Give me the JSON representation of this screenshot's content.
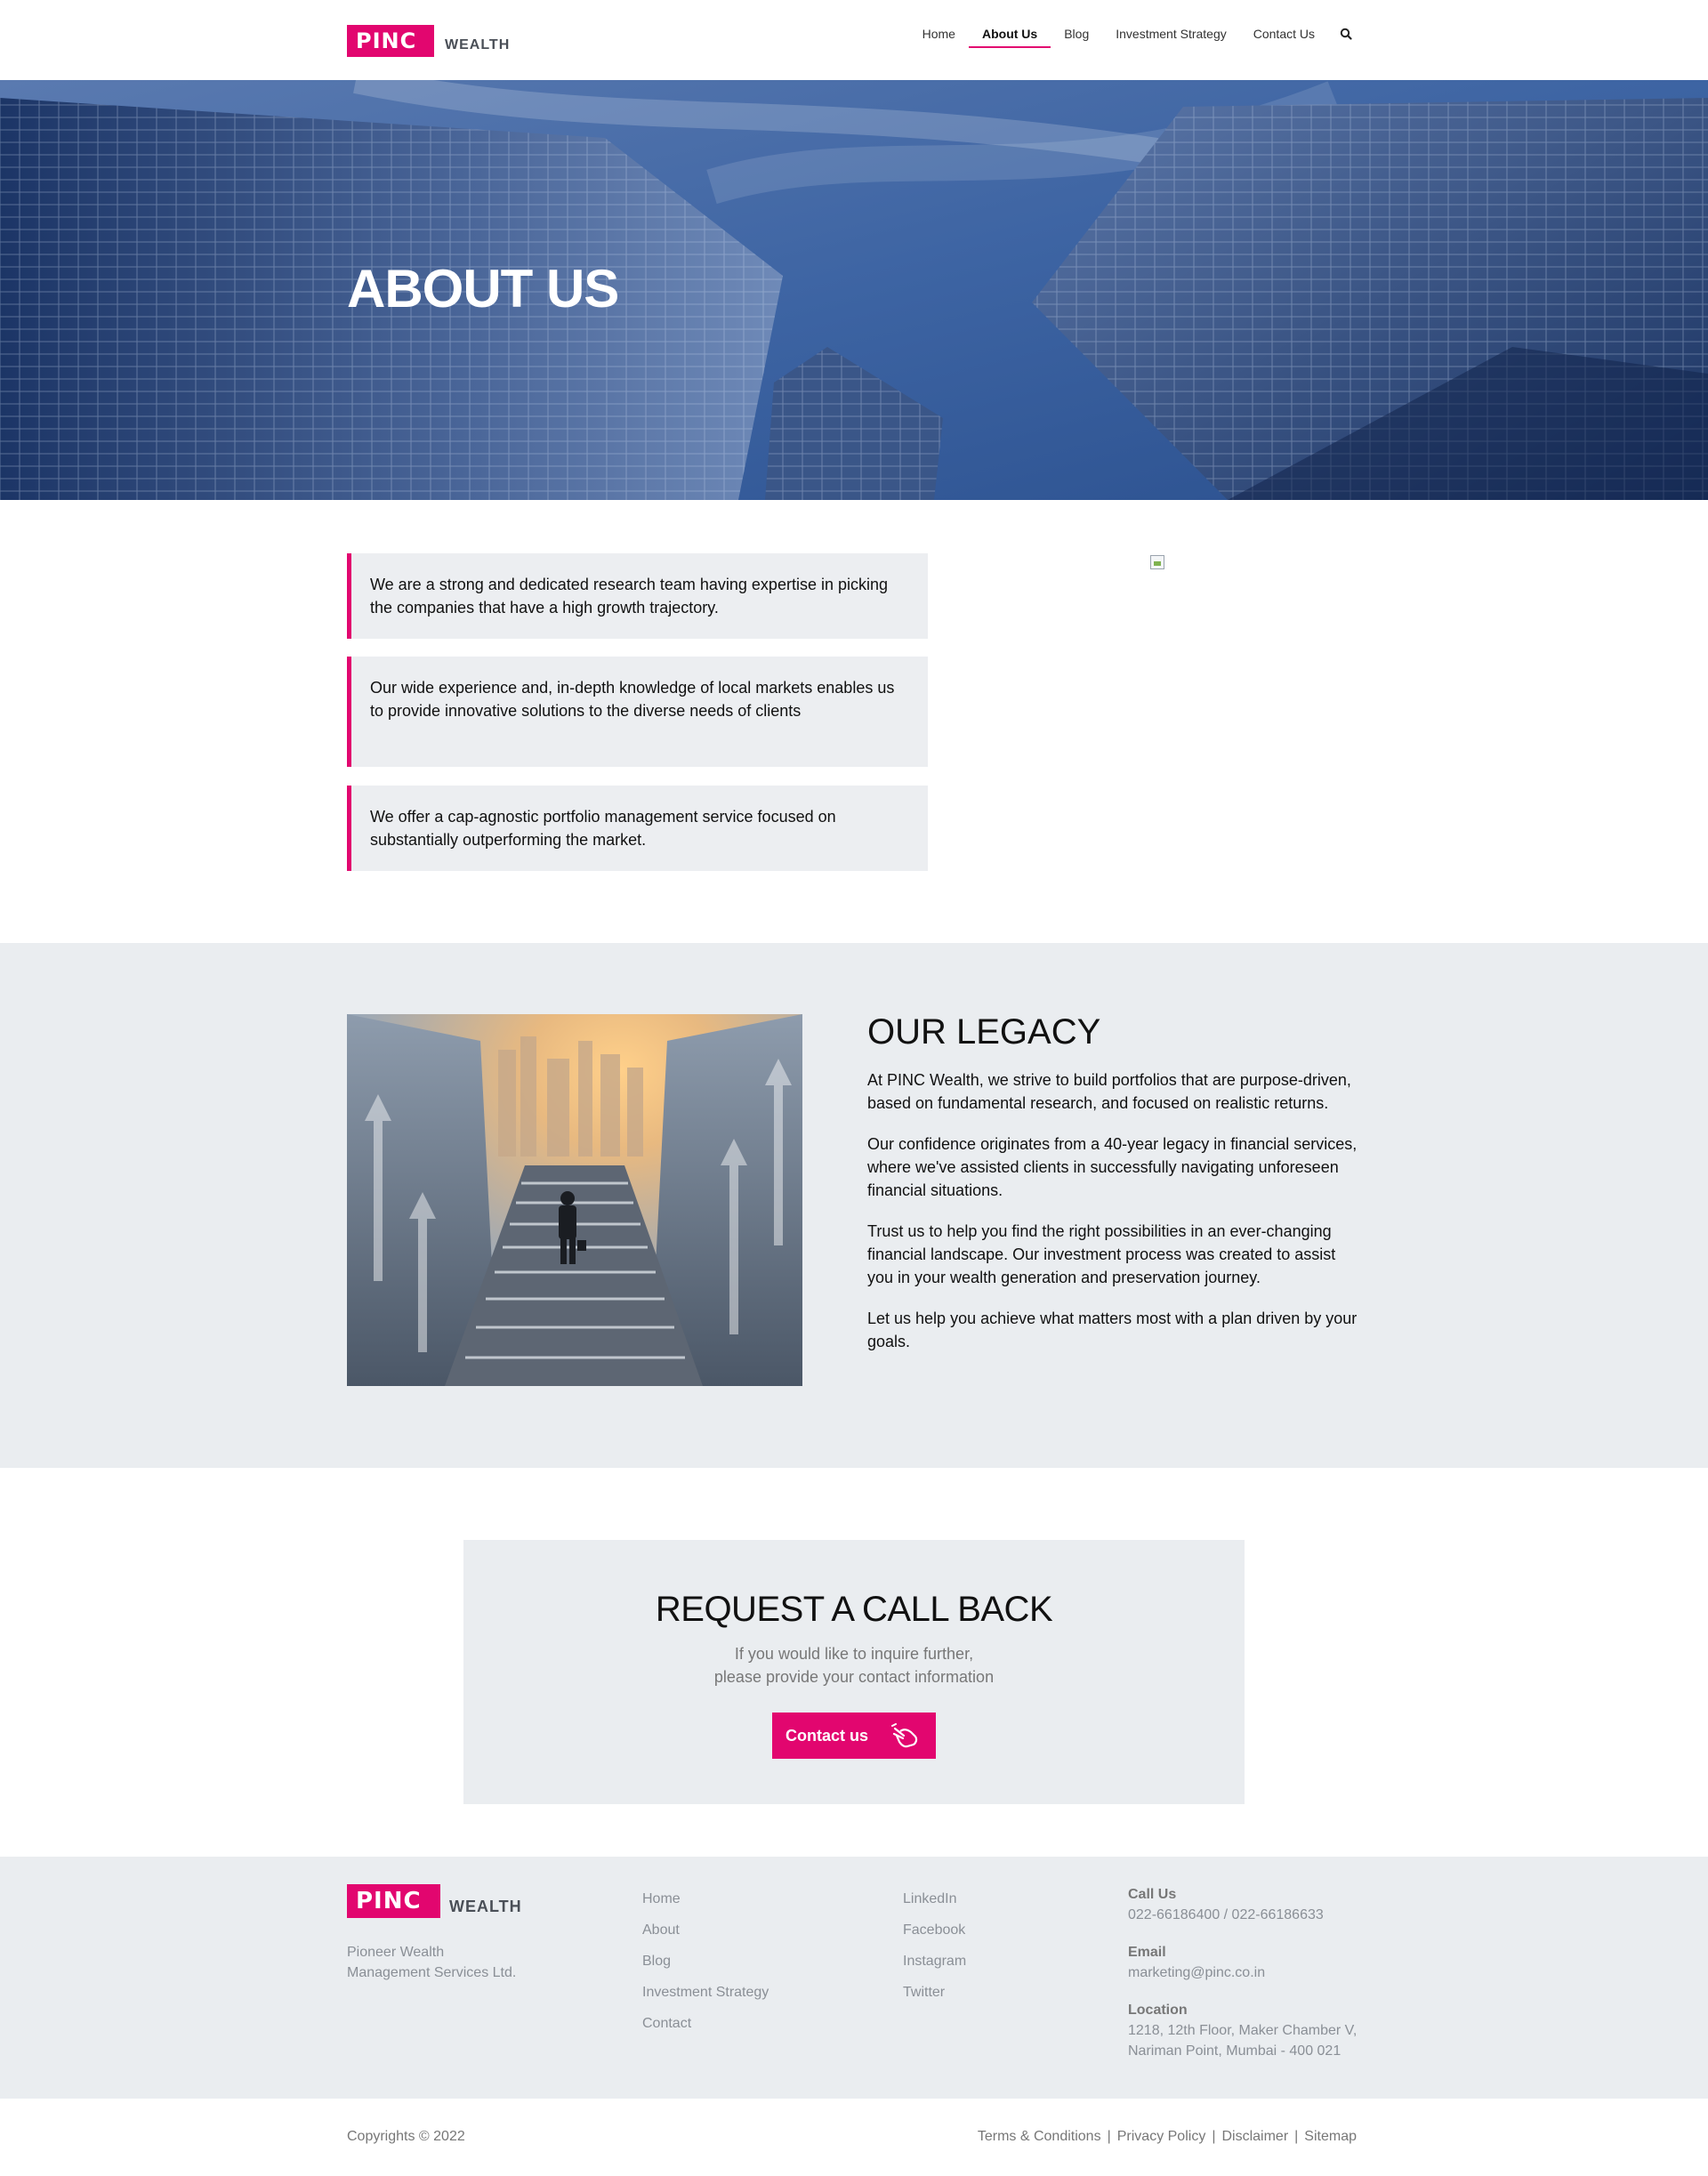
{
  "brand": {
    "mark": "PINC",
    "word": "WEALTH",
    "accent": "#e2066f"
  },
  "nav": {
    "items": [
      "Home",
      "About Us",
      "Blog",
      "Investment Strategy",
      "Contact Us"
    ],
    "active": "About Us",
    "search_icon": "search-icon"
  },
  "hero": {
    "title": "ABOUT US"
  },
  "features": [
    "We are a strong and dedicated research team having expertise in picking the companies that have a high growth trajectory.",
    "Our wide experience and, in-depth knowledge of local markets enables us to provide innovative solutions to the diverse needs of clients",
    "We offer a cap-agnostic portfolio management service focused on substantially outperforming the market."
  ],
  "legacy": {
    "title": "OUR LEGACY",
    "paragraphs": [
      "At PINC Wealth, we strive to build portfolios that are purpose-driven, based on fundamental research, and focused on realistic returns.",
      "Our confidence originates from a 40-year legacy in financial services, where we've assisted clients in successfully navigating unforeseen financial situations.",
      "Trust us to help you find the right possibilities in an ever-changing financial landscape. Our investment process was created to assist you in your wealth generation and preservation journey.",
      "Let us help you achieve what matters most with a plan driven by your goals."
    ]
  },
  "callback": {
    "title": "REQUEST A CALL BACK",
    "line1": "If you would like to inquire further,",
    "line2": "please provide your contact information",
    "button": "Contact us",
    "button_icon": "hand-pointer-icon"
  },
  "footer": {
    "company": "Pioneer Wealth Management Services Ltd.",
    "links": [
      "Home",
      "About",
      "Blog",
      "Investment Strategy",
      "Contact"
    ],
    "social": [
      "LinkedIn",
      "Facebook",
      "Instagram",
      "Twitter"
    ],
    "call_label": "Call Us",
    "call_value": "022-66186400 / 022-66186633",
    "email_label": "Email",
    "email_value": "marketing@pinc.co.in",
    "location_label": "Location",
    "location_line1": "1218, 12th Floor, Maker Chamber V,",
    "location_line2": "Nariman Point, Mumbai - 400 021",
    "copyright": "Copyrights © 2022",
    "legal": [
      "Terms & Conditions",
      "Privacy Policy",
      "Disclaimer",
      "Sitemap"
    ]
  }
}
